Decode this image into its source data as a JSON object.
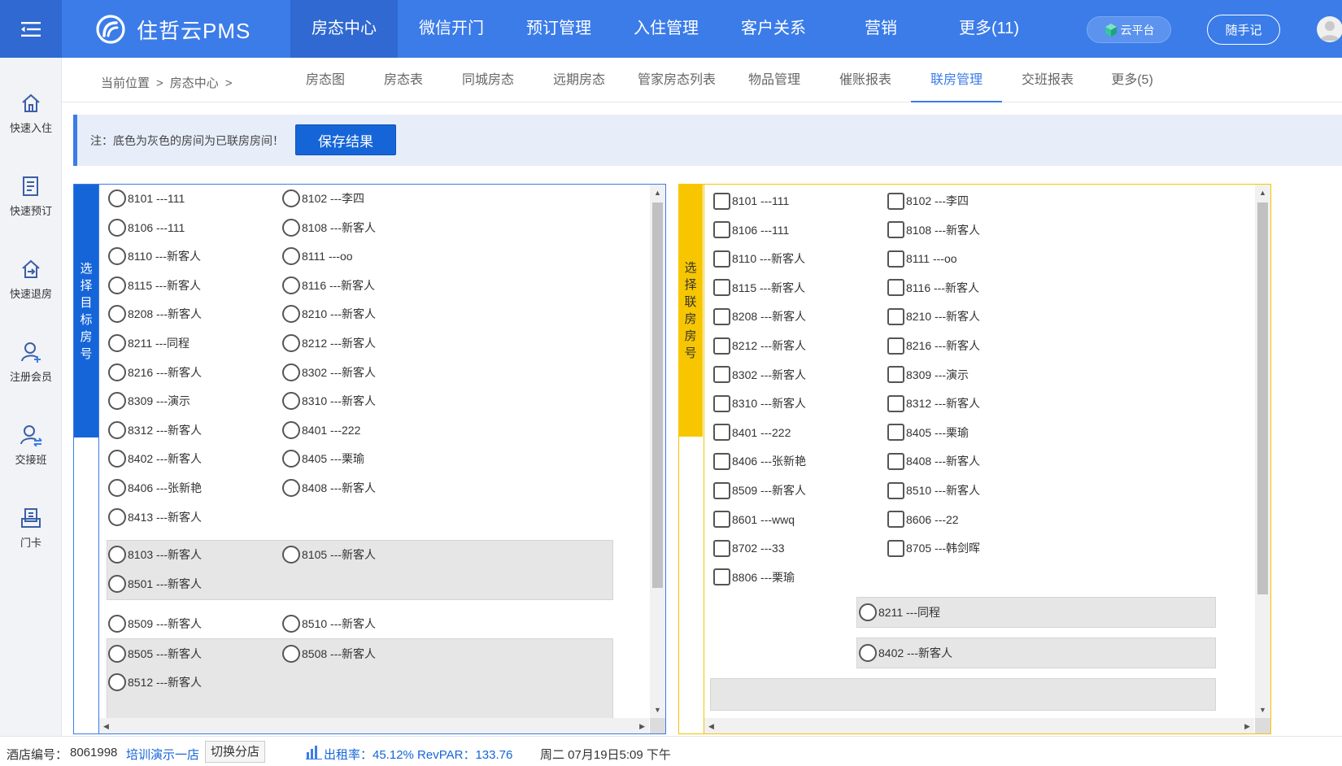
{
  "brand": {
    "name": "住哲云PMS"
  },
  "nav": [
    {
      "label": "房态中心",
      "active": true
    },
    {
      "label": "微信开门"
    },
    {
      "label": "预订管理"
    },
    {
      "label": "入住管理"
    },
    {
      "label": "客户关系"
    },
    {
      "label": "营销"
    },
    {
      "label": "更多(11)"
    }
  ],
  "header": {
    "cloud_label": "云平台",
    "note_label": "随手记"
  },
  "sidebar": [
    {
      "label": "快速入住",
      "icon": "home-icon"
    },
    {
      "label": "快速预订",
      "icon": "document-icon"
    },
    {
      "label": "快速退房",
      "icon": "checkout-icon"
    },
    {
      "label": "注册会员",
      "icon": "add-user-icon"
    },
    {
      "label": "交接班",
      "icon": "shift-icon"
    },
    {
      "label": "门卡",
      "icon": "card-icon"
    }
  ],
  "breadcrumb": {
    "prefix": "当前位置",
    "current": "房态中心",
    "sep": ">"
  },
  "subtabs": [
    {
      "label": "房态图"
    },
    {
      "label": "房态表"
    },
    {
      "label": "同城房态"
    },
    {
      "label": "远期房态"
    },
    {
      "label": "管家房态列表"
    },
    {
      "label": "物品管理"
    },
    {
      "label": "催账报表"
    },
    {
      "label": "联房管理",
      "active": true
    },
    {
      "label": "交班报表"
    },
    {
      "label": "更多(5)"
    }
  ],
  "notice": {
    "text": "注：底色为灰色的房间为已联房房间！",
    "save_label": "保存结果"
  },
  "left_panel": {
    "title": "选择目标房号",
    "rooms": [
      "8101 ---111",
      "8102 ---李四",
      "8106 ---111",
      "8108 ---新客人",
      "8110 ---新客人",
      "8111 ---oo",
      "8115 ---新客人",
      "8116 ---新客人",
      "8208 ---新客人",
      "8210 ---新客人",
      "8211 ---同程",
      "8212 ---新客人",
      "8216 ---新客人",
      "8302 ---新客人",
      "8309 ---演示",
      "8310 ---新客人",
      "8312 ---新客人",
      "8401 ---222",
      "8402 ---新客人",
      "8405 ---栗瑜",
      "8406 ---张新艳",
      "8408 ---新客人",
      "8413 ---新客人"
    ],
    "linked_groups": [
      [
        "8103 ---新客人",
        "8105 ---新客人",
        "8501 ---新客人"
      ],
      [
        "8505 ---新客人",
        "8508 ---新客人",
        "8512 ---新客人"
      ]
    ],
    "pair_between": [
      "8509 ---新客人",
      "8510 ---新客人"
    ]
  },
  "right_panel": {
    "title": "选择联房房号",
    "rooms": [
      "8101 ---111",
      "8102 ---李四",
      "8106 ---111",
      "8108 ---新客人",
      "8110 ---新客人",
      "8111 ---oo",
      "8115 ---新客人",
      "8116 ---新客人",
      "8208 ---新客人",
      "8210 ---新客人",
      "8212 ---新客人",
      "8216 ---新客人",
      "8302 ---新客人",
      "8309 ---演示",
      "8310 ---新客人",
      "8312 ---新客人",
      "8401 ---222",
      "8405 ---栗瑜",
      "8406 ---张新艳",
      "8408 ---新客人",
      "8509 ---新客人",
      "8510 ---新客人",
      "8601 ---wwq",
      "8606 ---22",
      "8702 ---33",
      "8705 ---韩剑晖",
      "8806 ---栗瑜"
    ],
    "linked": [
      "8211 ---同程",
      "8402 ---新客人"
    ]
  },
  "footer": {
    "hotel_no_label": "酒店编号：",
    "hotel_no": "8061998",
    "hotel_name": "培训演示一店",
    "switch_label": "切换分店",
    "occupancy": "出租率：45.12% RevPAR：133.76",
    "datetime": "周二 07月19日5:09 下午"
  },
  "colors": {
    "primary": "#3b7ce9",
    "primary_dark": "#2f69d1",
    "accent_yellow": "#f7c600",
    "linked_gray": "#e6e6e6"
  }
}
